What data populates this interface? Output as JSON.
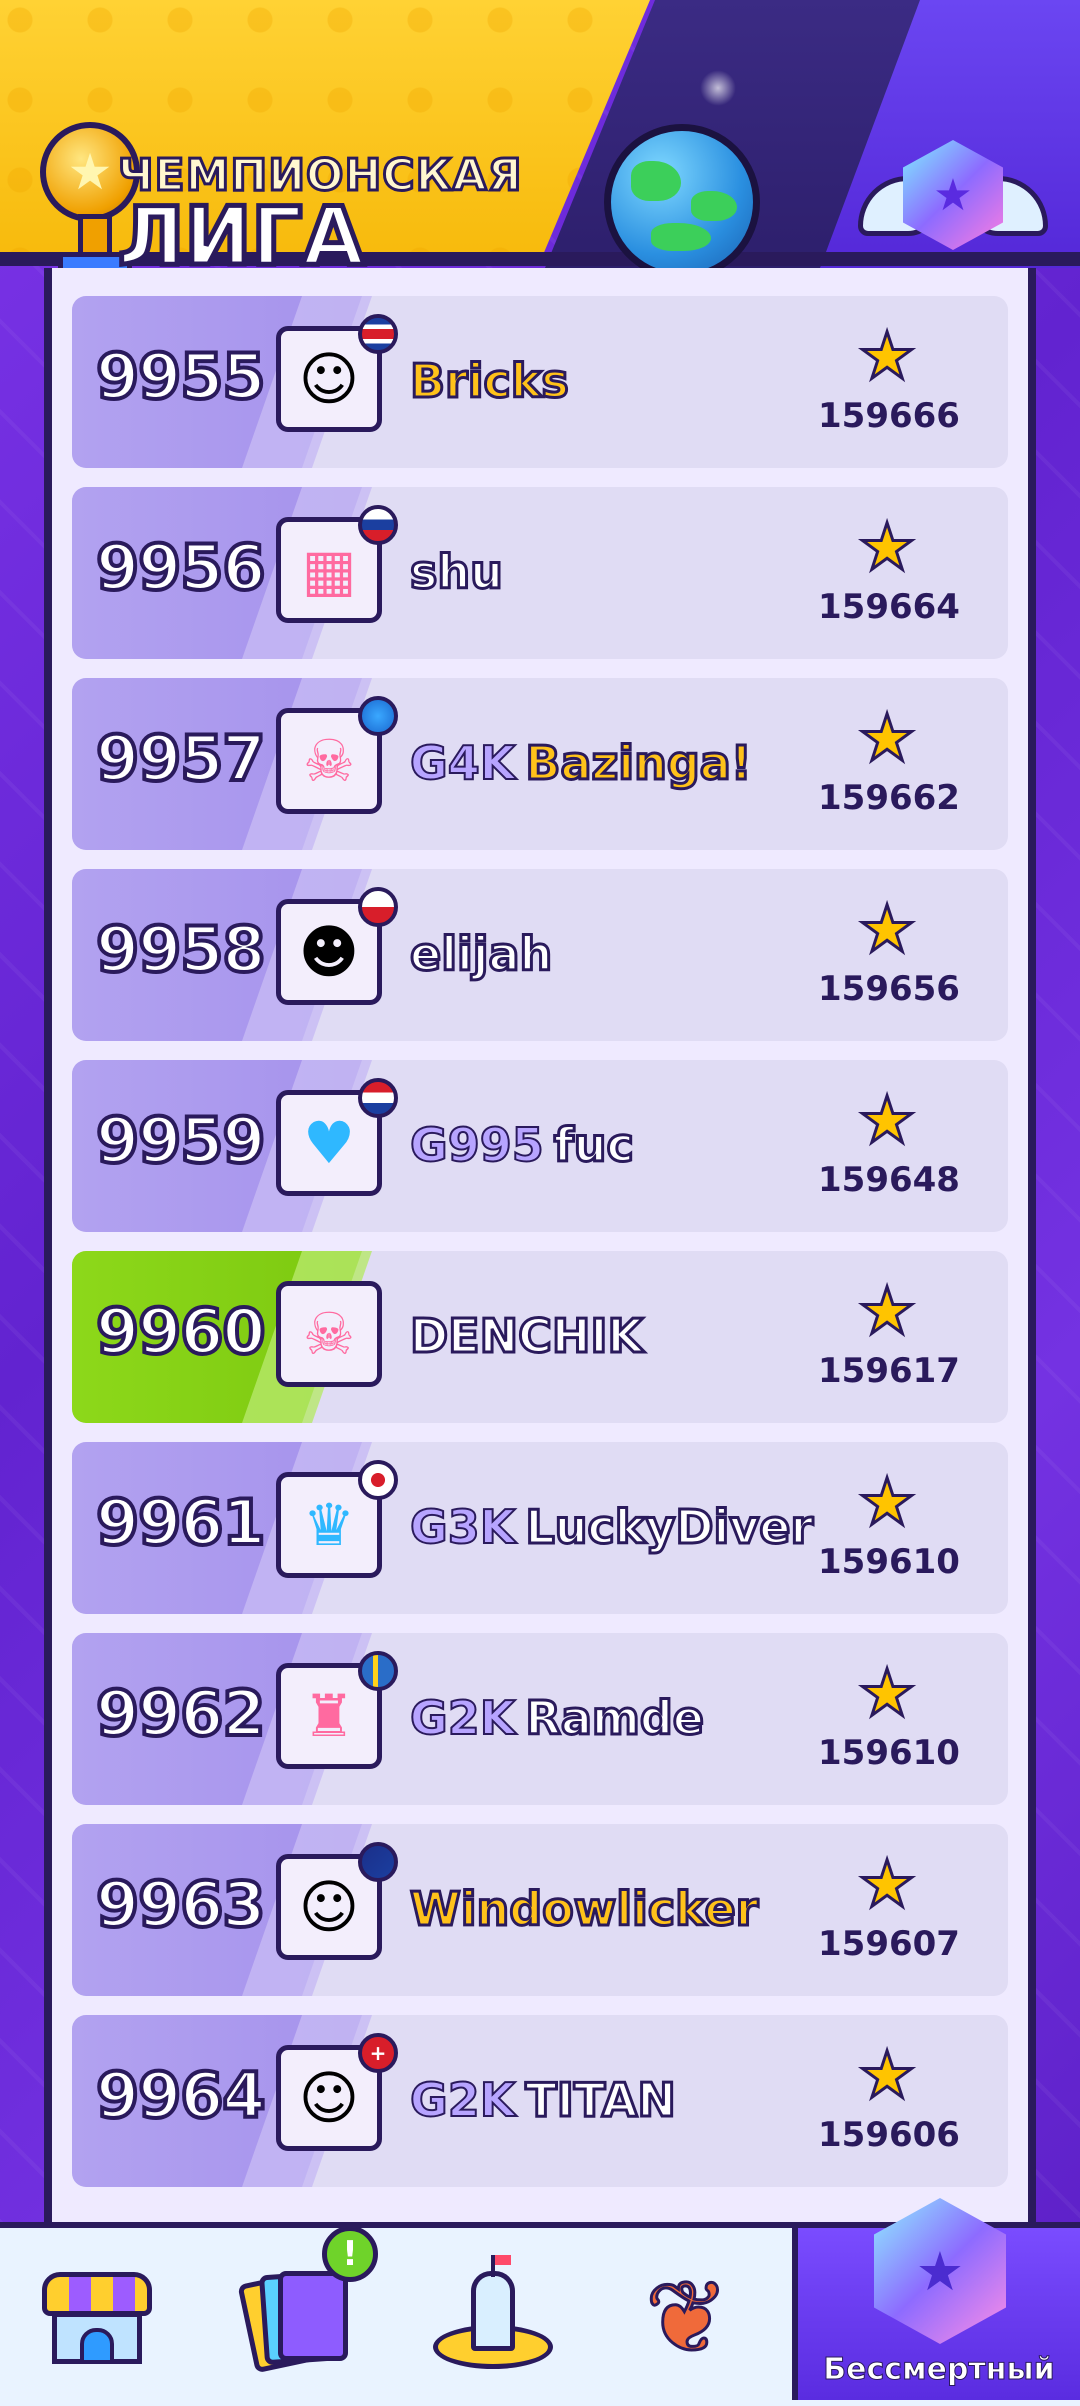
{
  "header": {
    "league_title_line1": "ЧЕМПИОНСКАЯ",
    "league_title_line2": "ЛИГА"
  },
  "leaderboard": {
    "rows": [
      {
        "rank": "9955",
        "clan": "",
        "nick": "Bricks",
        "nick_style": "gold",
        "avatar": "woman-sunglasses",
        "avatar_glyph": "☺",
        "flag": "costa-rica",
        "score": "159666"
      },
      {
        "rank": "9956",
        "clan": "",
        "nick": "shu",
        "nick_style": "white",
        "avatar": "gift-boxes",
        "avatar_glyph": "▦",
        "flag": "slovakia",
        "score": "159664"
      },
      {
        "rank": "9957",
        "clan": "G4K",
        "nick": "Bazinga!",
        "nick_style": "gold",
        "avatar": "skulls-swords",
        "avatar_glyph": "☠",
        "flag": "globe",
        "score": "159662"
      },
      {
        "rank": "9958",
        "clan": "",
        "nick": "elijah",
        "nick_style": "white",
        "avatar": "bald-man",
        "avatar_glyph": "☻",
        "flag": "poland",
        "score": "159656"
      },
      {
        "rank": "9959",
        "clan": "G995",
        "nick": "fuc",
        "nick_style": "white",
        "avatar": "blue-pig",
        "avatar_glyph": "♥",
        "flag": "paraguay",
        "score": "159648"
      },
      {
        "rank": "9960",
        "clan": "",
        "nick": "DENCHIK",
        "nick_style": "white",
        "avatar": "skulls-swords",
        "avatar_glyph": "☠",
        "flag": "",
        "score": "159617",
        "current_player": true
      },
      {
        "rank": "9961",
        "clan": "G3K",
        "nick": "LuckyDiver",
        "nick_style": "white",
        "avatar": "crowned-blue-pig",
        "avatar_glyph": "♛",
        "flag": "japan",
        "score": "159610"
      },
      {
        "rank": "9962",
        "clan": "G2K",
        "nick": "Ramde",
        "nick_style": "white",
        "avatar": "pink-castle",
        "avatar_glyph": "♜",
        "flag": "sweden",
        "score": "159610"
      },
      {
        "rank": "9963",
        "clan": "",
        "nick": "Windowlicker",
        "nick_style": "gold",
        "avatar": "bearded-man",
        "avatar_glyph": "☺",
        "flag": "australia",
        "score": "159607"
      },
      {
        "rank": "9964",
        "clan": "G2K",
        "nick": "TITAN",
        "nick_style": "white",
        "avatar": "bearded-man",
        "avatar_glyph": "☺",
        "flag": "switzerland",
        "score": "159606"
      }
    ]
  },
  "bottom_nav": {
    "active_label": "Бессмертный",
    "cards_alert": "!",
    "items": [
      "shop-icon",
      "cards-icon",
      "city-icon",
      "leaf-icon",
      "immortal-league-icon"
    ]
  },
  "colors": {
    "outline": "#2a1a5c",
    "current_player_green": "#8dd81a",
    "rank_purple": "#a592ec",
    "star_gold": "#ffc400"
  }
}
